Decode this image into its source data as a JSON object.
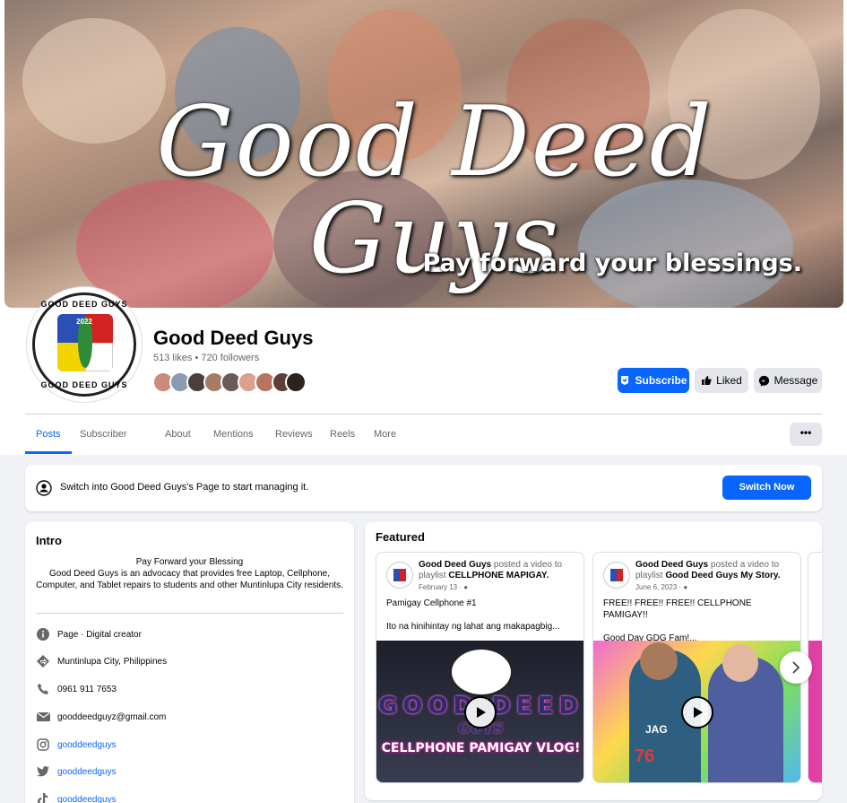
{
  "cover": {
    "title": "Good Deed Guys",
    "tagline": "Pay forward your blessings."
  },
  "logo": {
    "ring_text_top": "GOOD DEED GUYS",
    "year": "2022"
  },
  "profile": {
    "name": "Good Deed Guys",
    "stats": "513 likes • 720 followers"
  },
  "actions": {
    "subscribe": "Subscribe",
    "liked": "Liked",
    "message": "Message"
  },
  "tabs": [
    "Posts",
    "Subscriber hub",
    "About",
    "Mentions",
    "Reviews",
    "Reels",
    "More"
  ],
  "more_menu_dots": "•••",
  "switch_banner": {
    "text": "Switch into Good Deed Guys's Page to start managing it.",
    "button": "Switch Now"
  },
  "intro": {
    "title": "Intro",
    "bio_line1": "Pay Forward your Blessing",
    "bio_line2": "Good Deed Guys is an advocacy that provides free Laptop, Cellphone, Computer, and Tablet repairs to students and other Muntinlupa City residents.",
    "items": [
      {
        "icon": "info-icon",
        "text": "Page · Digital creator"
      },
      {
        "icon": "location-icon",
        "text": "Muntinlupa City, Philippines"
      },
      {
        "icon": "phone-icon",
        "text": "0961 911 7653"
      },
      {
        "icon": "email-icon",
        "text": "gooddeedguyz@gmail.com"
      },
      {
        "icon": "instagram-icon",
        "text": "gooddeedguys"
      },
      {
        "icon": "twitter-icon",
        "text": "gooddeedguys"
      },
      {
        "icon": "tiktok-icon",
        "text": "gooddeedguys"
      }
    ]
  },
  "featured": {
    "title": "Featured",
    "posts": [
      {
        "author": "Good Deed Guys",
        "action": " posted a video to playlist ",
        "playlist": "CELLPHONE MAPIGAY.",
        "date": "February 13 ·",
        "body_line1": "Pamigay Cellphone #1",
        "body_line2": "Ito na hinihintay ng lahat ang makapagbig...",
        "thumb_line1": "GOOD DEED",
        "thumb_line2": "GUYS",
        "thumb_line3": "CELLPHONE PAMIGAY VLOG!"
      },
      {
        "author": "Good Deed Guys",
        "action": " posted a video to playlist ",
        "playlist": "Good Deed Guys My Story.",
        "date": "June 6, 2023 ·",
        "body_line1": "FREE!! FREE!! FREE!! CELLPHONE PAMIGAY!!",
        "body_line2": "Good Day GDG Fam!...",
        "thumb_shirt": "JAG",
        "thumb_number": "76"
      }
    ]
  },
  "colors": {
    "primary": "#0866ff",
    "background": "#f0f2f5",
    "secondary_text": "#65676b"
  }
}
